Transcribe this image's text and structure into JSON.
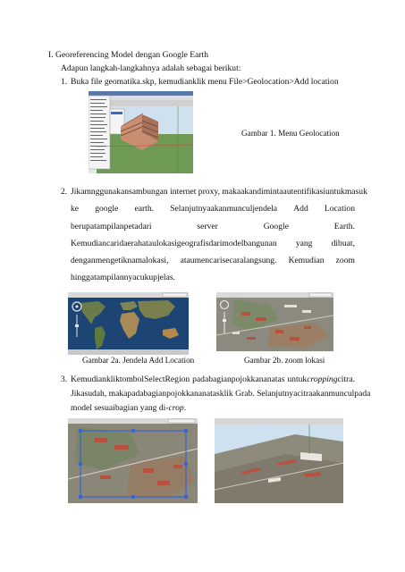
{
  "heading": "I.  Georeferencing Model dengan Google Earth",
  "intro": "Adapun langkah-langkahnya adalah sebagai berikut:",
  "steps": [
    {
      "num": "1.",
      "text": "Buka file geomatika.skp, kemudianklik menu File>Geolocation>Add location",
      "figure_caption": "Gambar 1. Menu Geolocation"
    },
    {
      "num": "2.",
      "lines": [
        "Jikamnggunakansambungan internet proxy, makaakandimintaautentifikasiuntukmasuk",
        [
          "ke",
          "google",
          "earth.",
          "Selanjutnyaakanmunculjendela",
          "Add",
          "Location"
        ],
        [
          "berupatampilanpetadari",
          "server",
          "Google",
          "Earth."
        ],
        [
          "Kemudiancaridaerahataulokasigeografisdarimodelbangunan",
          "yang",
          "dibuat,"
        ],
        [
          "denganmengetiknamalokasi,",
          "ataumencarisecaralangsung.",
          "Kemudian",
          "zoom"
        ],
        "hinggatampilannyacukupjelas."
      ],
      "caption_a": "Gambar 2a. Jendela Add Location",
      "caption_b": "Gambar 2b. zoom lokasi"
    },
    {
      "num": "3.",
      "line1_a": "KemudiankliktombolSelectRegion",
      "line1_b": "padabagianpojokkananatas",
      "line1_c": "untuk",
      "line1_em": "cropping",
      "line1_d": "citra.",
      "line2": "Jikasudah, makapadabagianpojokkananatasklik Grab. Selanjutnyacitraakanmunculpada",
      "line3_a": "model sesuaibagian yang di-",
      "line3_em": "crop",
      "line3_b": "."
    }
  ],
  "colors": {
    "sky": "#cfe0ee",
    "grass": "#6f9a56",
    "building": "#c98e72",
    "ocean": "#1d4573",
    "land": "#6b7c4a",
    "urban": "#8c8a7f"
  }
}
